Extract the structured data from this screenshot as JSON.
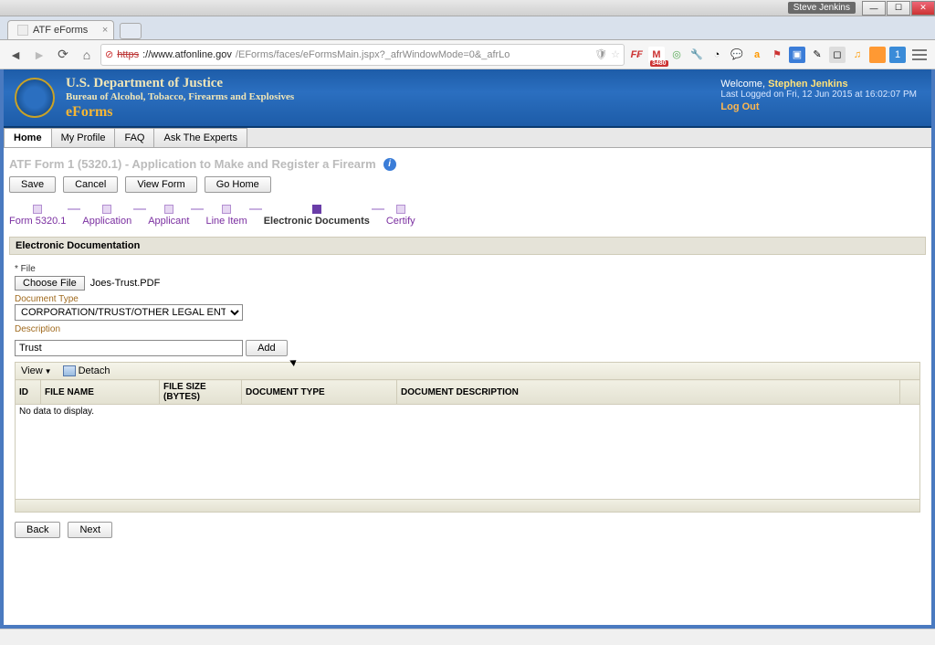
{
  "windows": {
    "user_badge": "Steve Jenkins"
  },
  "browser": {
    "tab_title": "ATF eForms",
    "url_scheme": "https",
    "url_host": "://www.atfonline.gov",
    "url_rest": "/EForms/faces/eFormsMain.jspx?_afrWindowMode=0&_afrLo",
    "ff_icon": "F₣",
    "gmail_badge": "3480"
  },
  "header": {
    "dept": "U.S. Department of Justice",
    "bureau": "Bureau of Alcohol, Tobacco, Firearms and Explosives",
    "app": "eForms",
    "welcome_label": "Welcome,",
    "welcome_name": "Stephen Jenkins",
    "last_logged": "Last Logged on Fri, 12 Jun 2015 at 16:02:07 PM",
    "logout": "Log Out"
  },
  "nav": {
    "tabs": [
      "Home",
      "My Profile",
      "FAQ",
      "Ask The Experts"
    ]
  },
  "page": {
    "title": "ATF Form 1 (5320.1) - Application to Make and Register a Firearm",
    "buttons": {
      "save": "Save",
      "cancel": "Cancel",
      "view": "View Form",
      "gohome": "Go Home"
    },
    "train": [
      "Form 5320.1",
      "Application",
      "Applicant",
      "Line Item",
      "Electronic Documents",
      "Certify"
    ],
    "train_current_index": 4,
    "section_title": "Electronic Documentation",
    "file_label": "* File",
    "choose_file": "Choose File",
    "chosen_filename": "Joes-Trust.PDF",
    "doc_type_label": "Document Type",
    "doc_type_value": "CORPORATION/TRUST/OTHER LEGAL ENTITY",
    "description_label": "Description",
    "description_value": "Trust",
    "add": "Add",
    "view_menu": "View",
    "detach": "Detach",
    "columns": [
      "ID",
      "FILE NAME",
      "FILE SIZE (BYTES)",
      "DOCUMENT TYPE",
      "DOCUMENT DESCRIPTION"
    ],
    "no_data": "No data to display.",
    "back": "Back",
    "next": "Next"
  }
}
